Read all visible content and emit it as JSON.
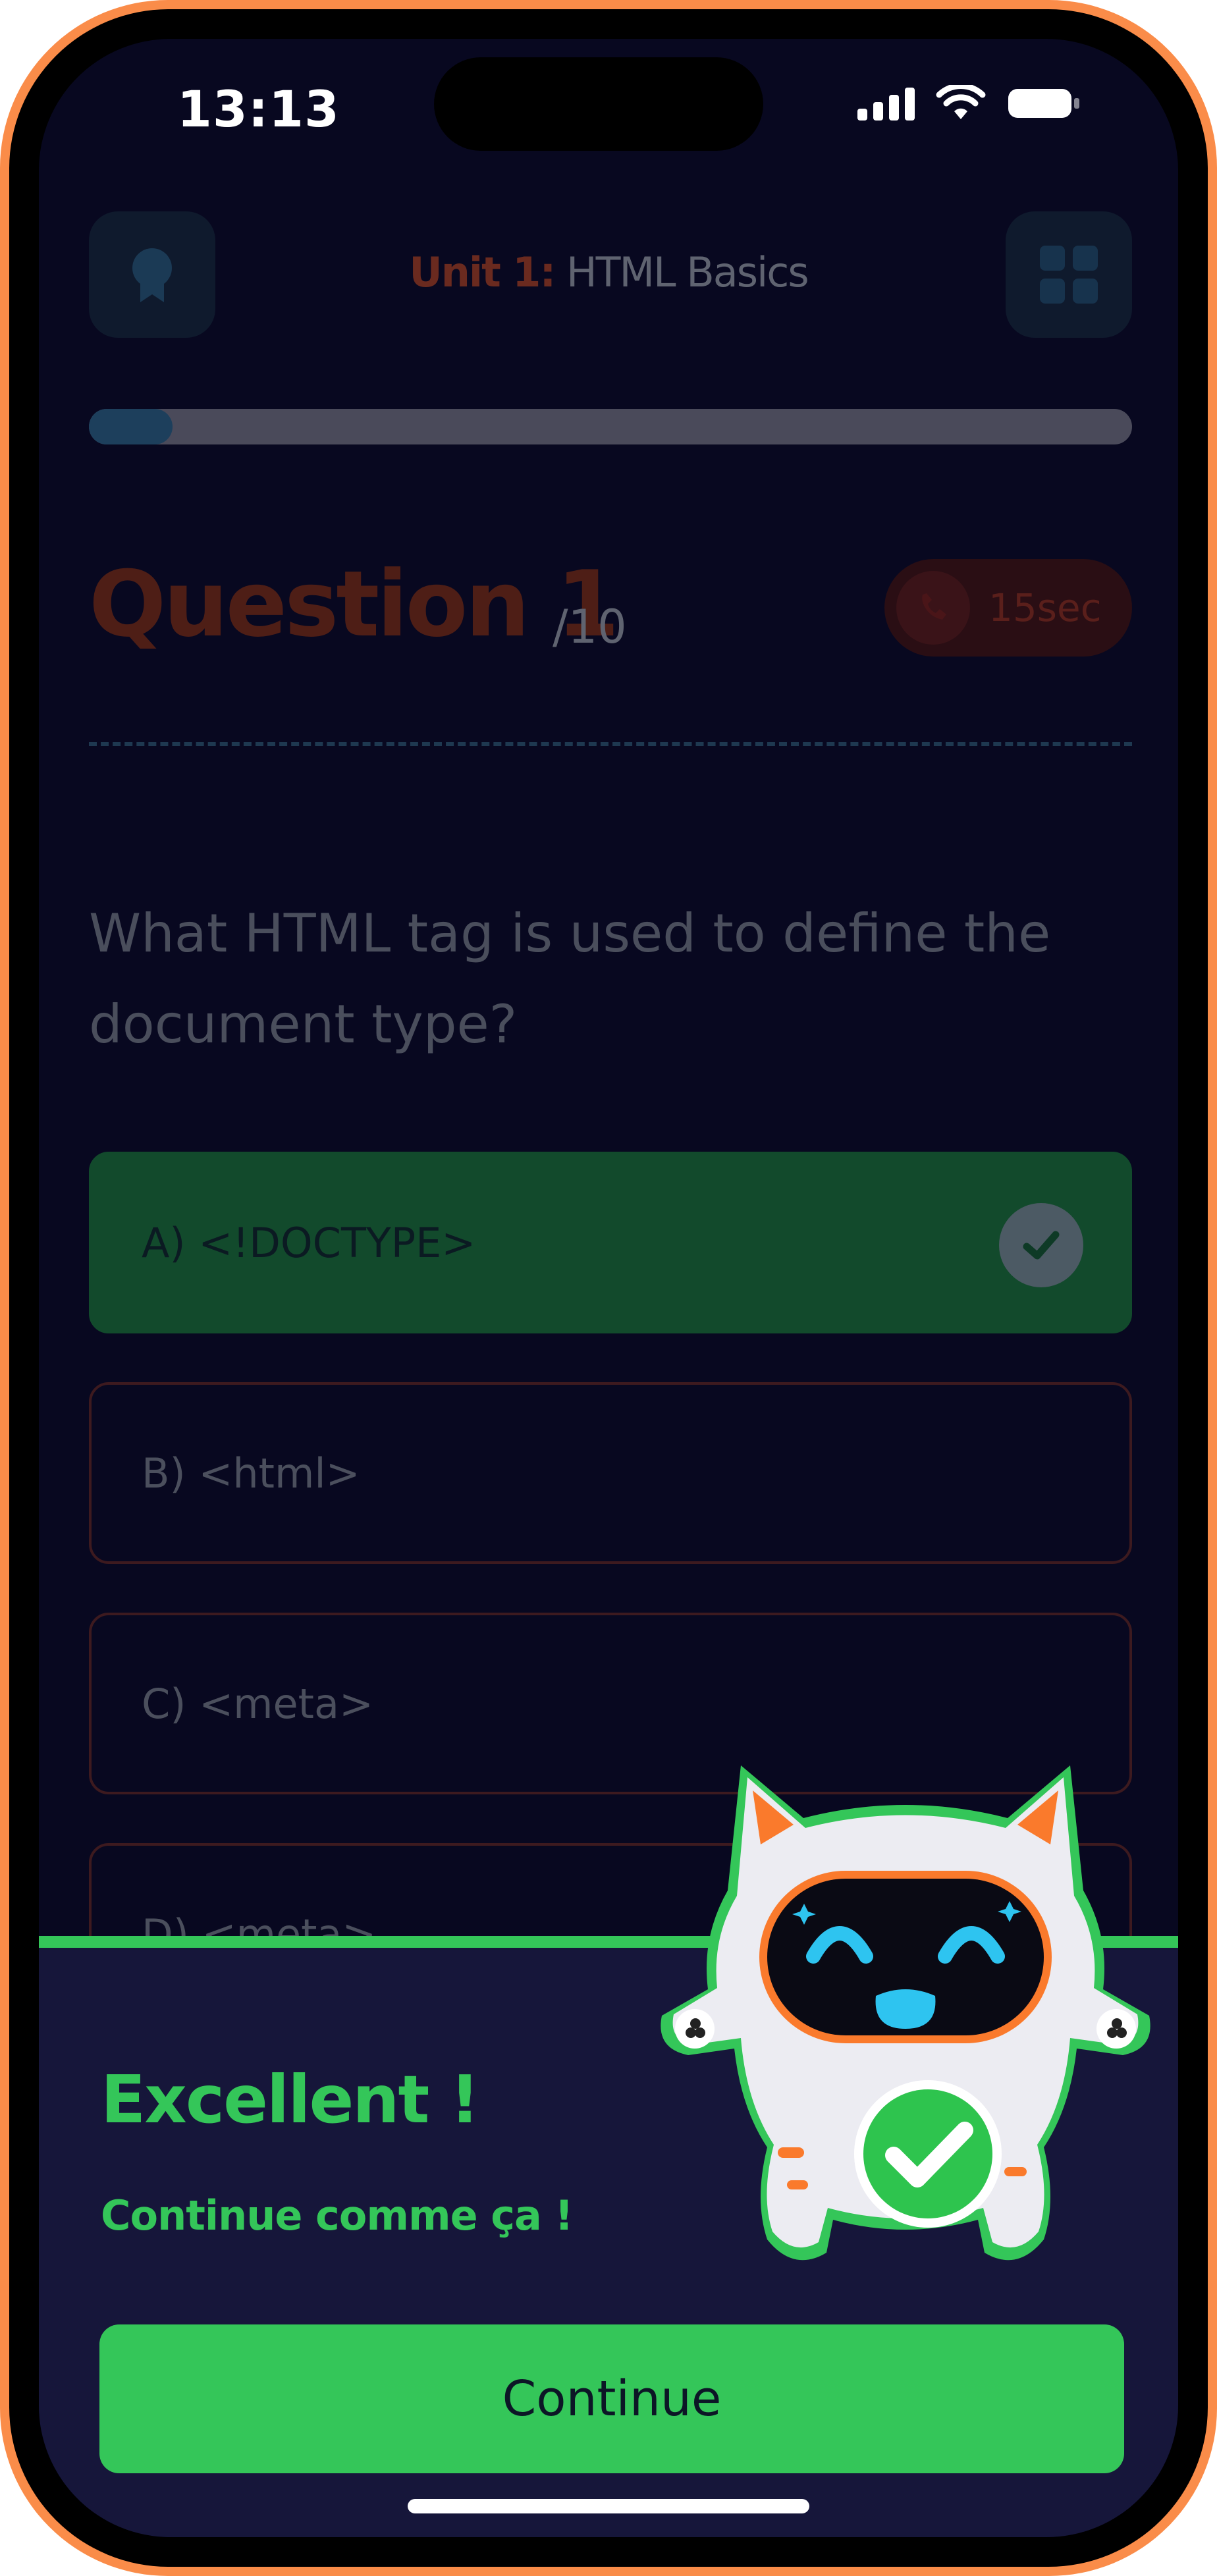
{
  "status_bar": {
    "time": "13:13"
  },
  "header": {
    "unit_label": "Unit 1:",
    "unit_title": "HTML Basics"
  },
  "progress": {
    "value": 0.08
  },
  "question": {
    "title": "Question 1",
    "total": "/10",
    "timer": "15sec",
    "text": "What HTML tag is used to define the document type?"
  },
  "options": [
    {
      "label": "A) <!DOCTYPE>",
      "correct": true
    },
    {
      "label": "B) <html>",
      "correct": false
    },
    {
      "label": "C) <meta>",
      "correct": false
    },
    {
      "label": "D) <meta>",
      "correct": false
    }
  ],
  "feedback": {
    "title": "Excellent !",
    "subtitle": "Continue comme ça !",
    "button_label": "Continue"
  },
  "colors": {
    "frame": "#FA8C49",
    "accent_green": "#34C659",
    "background": "#080820",
    "sheet": "#16163A"
  }
}
